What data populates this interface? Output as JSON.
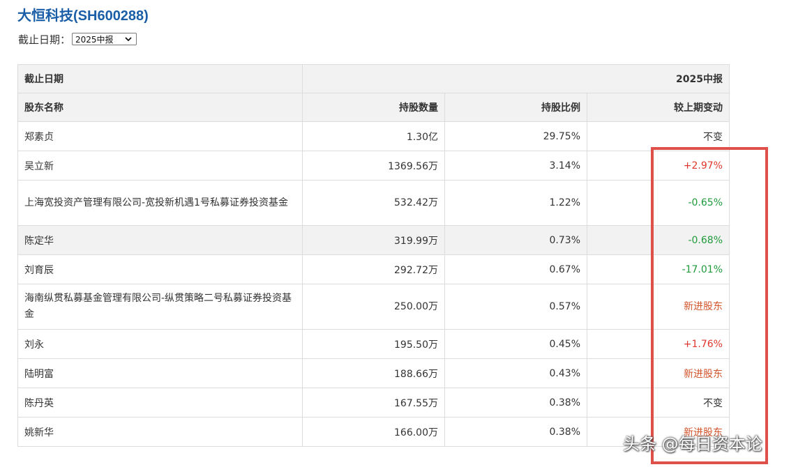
{
  "page": {
    "title": "大恒科技(SH600288)",
    "date_label": "截止日期：",
    "date_select_value": "2025中报"
  },
  "table": {
    "header_row1": {
      "label": "截止日期",
      "period": "2025中报"
    },
    "columns": [
      "股东名称",
      "持股数量",
      "持股比例",
      "较上期变动"
    ],
    "rows": [
      {
        "name": "郑素贞",
        "shares": "1.30亿",
        "ratio": "29.75%",
        "change": "不变",
        "change_type": "flat"
      },
      {
        "name": "吴立新",
        "shares": "1369.56万",
        "ratio": "3.14%",
        "change": "+2.97%",
        "change_type": "up"
      },
      {
        "name": "上海宽投资产管理有限公司-宽投新机遇1号私募证券投资基金",
        "shares": "532.42万",
        "ratio": "1.22%",
        "change": "-0.65%",
        "change_type": "down"
      },
      {
        "name": "陈定华",
        "shares": "319.99万",
        "ratio": "0.73%",
        "change": "-0.68%",
        "change_type": "down"
      },
      {
        "name": "刘育辰",
        "shares": "292.72万",
        "ratio": "0.67%",
        "change": "-17.01%",
        "change_type": "down"
      },
      {
        "name": "海南纵贯私募基金管理有限公司-纵贯策略二号私募证券投资基金",
        "shares": "250.00万",
        "ratio": "0.57%",
        "change": "新进股东",
        "change_type": "new"
      },
      {
        "name": "刘永",
        "shares": "195.50万",
        "ratio": "0.45%",
        "change": "+1.76%",
        "change_type": "up"
      },
      {
        "name": "陆明富",
        "shares": "188.66万",
        "ratio": "0.43%",
        "change": "新进股东",
        "change_type": "new"
      },
      {
        "name": "陈丹英",
        "shares": "167.55万",
        "ratio": "0.38%",
        "change": "不变",
        "change_type": "flat"
      },
      {
        "name": "姚新华",
        "shares": "166.00万",
        "ratio": "0.38%",
        "change": "新进股东",
        "change_type": "new"
      }
    ]
  },
  "colors": {
    "title": "#1a5ea8",
    "increase": "#e0362c",
    "decrease": "#1f9a3a",
    "new_holder": "#d2552c",
    "highlight_box": "#e0504a"
  },
  "watermark": "头条 @每日资本论",
  "icons": {
    "select_arrow": "chevron-down-icon"
  }
}
